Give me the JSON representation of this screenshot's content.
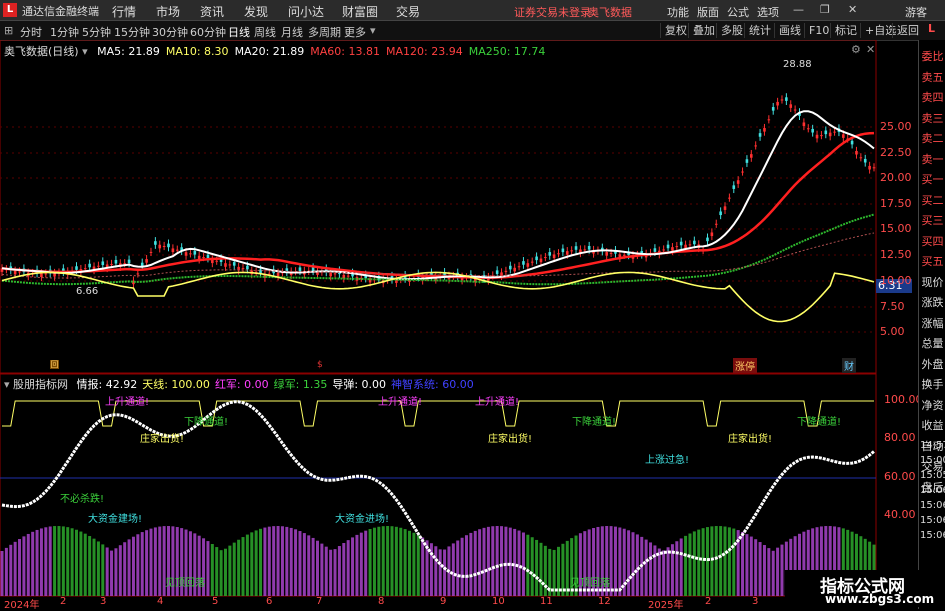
{
  "title_bar": {
    "logo": "L",
    "app_title": "通达信金融终端",
    "menus": [
      "行情",
      "市场",
      "资讯",
      "发现",
      "问小达",
      "财富圈",
      "交易"
    ],
    "notice": "证券交易未登录",
    "brand": "奥飞数据",
    "right_menus": [
      "功能",
      "版面",
      "公式",
      "选项"
    ],
    "guest": "游客"
  },
  "toolbar": {
    "periods": [
      "分时",
      "1分钟",
      "5分钟",
      "15分钟",
      "30分钟",
      "60分钟",
      "日线",
      "周线",
      "月线",
      "多周期",
      "更多"
    ],
    "active_period": "日线",
    "right_buttons": [
      "复权",
      "叠加",
      "多股",
      "统计",
      "画线",
      "F10",
      "标记",
      "+自选",
      "返回"
    ]
  },
  "main_chart": {
    "stock_label": "奥飞数据(日线)",
    "ma": [
      {
        "label": "MA5:",
        "value": "21.89",
        "color": "#ffffff"
      },
      {
        "label": "MA10:",
        "value": "8.30",
        "color": "#ffff66"
      },
      {
        "label": "MA20:",
        "value": "21.89",
        "color": "#ffffff"
      },
      {
        "label": "MA60:",
        "value": "13.81",
        "color": "#ff4040"
      },
      {
        "label": "MA120:",
        "value": "23.94",
        "color": "#ff4040"
      },
      {
        "label": "MA250:",
        "value": "17.74",
        "color": "#3bd13b"
      }
    ],
    "y_ticks": [
      "25.00",
      "22.50",
      "20.00",
      "17.50",
      "15.00",
      "12.50",
      "10.00",
      "7.50",
      "5.00"
    ],
    "high_label": "28.88",
    "low_label": "6.66",
    "current_value": "6.31",
    "markers": [
      "涨停",
      "财"
    ]
  },
  "indicator": {
    "name": "股朋指标网",
    "items": [
      {
        "label": "情报:",
        "value": "42.92",
        "color": "#ffffff"
      },
      {
        "label": "天线:",
        "value": "100.00",
        "color": "#ffff66"
      },
      {
        "label": "红军:",
        "value": "0.00",
        "color": "#ff40ff"
      },
      {
        "label": "绿军:",
        "value": "1.35",
        "color": "#3bd13b"
      },
      {
        "label": "导弹:",
        "value": "0.00",
        "color": "#ffffff"
      },
      {
        "label": "神智系统:",
        "value": "60.00",
        "color": "#4040ff"
      }
    ],
    "y_ticks": [
      "100.00",
      "80.00",
      "60.00",
      "40.00"
    ],
    "annotations": [
      {
        "text": "上升通道!",
        "color": "#ff40ff"
      },
      {
        "text": "下降通道!",
        "color": "#3bd13b"
      },
      {
        "text": "庄家出货!",
        "color": "#ffff66"
      },
      {
        "text": "不必杀跌!",
        "color": "#3bd13b"
      },
      {
        "text": "大资金建场!",
        "color": "#40e0e0"
      },
      {
        "text": "见顶回落",
        "color": "#3bd13b"
      },
      {
        "text": "大资金进场!",
        "color": "#40e0e0"
      },
      {
        "text": "上升通道!",
        "color": "#ff40ff"
      },
      {
        "text": "上升通道!",
        "color": "#ff40ff"
      },
      {
        "text": "庄家出货!",
        "color": "#ffff66"
      },
      {
        "text": "下降通道!",
        "color": "#3bd13b"
      },
      {
        "text": "上涨过急!",
        "color": "#40e0e0"
      },
      {
        "text": "见顶回落",
        "color": "#3bd13b"
      },
      {
        "text": "庄家出货!",
        "color": "#ffff66"
      },
      {
        "text": "下降通道!",
        "color": "#3bd13b"
      }
    ]
  },
  "x_axis": [
    "2024年",
    "2",
    "3",
    "4",
    "5",
    "6",
    "7",
    "8",
    "9",
    "10",
    "11",
    "12",
    "2025年",
    "2",
    "3"
  ],
  "side_panel": [
    "委比",
    "卖五",
    "卖四",
    "卖三",
    "卖二",
    "卖一",
    "买一",
    "买二",
    "买三",
    "买四",
    "买五",
    "现价",
    "涨跌",
    "涨幅",
    "总量",
    "外盘",
    "换手",
    "净资",
    "收益",
    "自动",
    "交易",
    "盘后"
  ],
  "side_times": [
    "14:57",
    "15:00",
    "15:05",
    "15:06",
    "15:06",
    "15:06",
    "15:06"
  ],
  "watermark": {
    "text": "指标公式网",
    "url": "www.zbgs3.com"
  }
}
